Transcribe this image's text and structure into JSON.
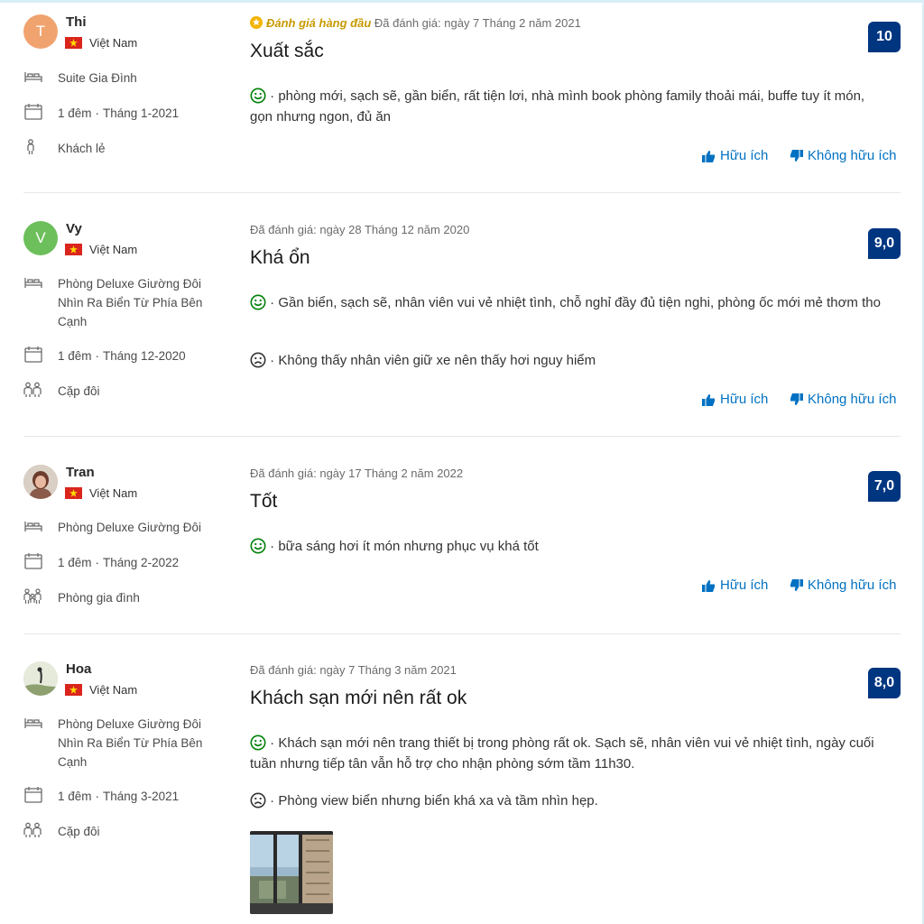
{
  "labels": {
    "helpful": "Hữu ích",
    "not_helpful": "Không hữu ích",
    "top_review": "Đánh giá hàng đầu"
  },
  "colors": {
    "score_bg": "#003580",
    "link": "#0071c2",
    "positive": "#008009",
    "top_badge": "#f4b400"
  },
  "reviews": [
    {
      "avatar_letter": "T",
      "avatar_color": "#f0a36f",
      "name": "Thi",
      "country": "Việt Nam",
      "room": "Suite Gia Đình",
      "nights": "1 đêm",
      "stay_month": "Tháng 1-2021",
      "traveler_type": "Khách lẻ",
      "review_date": "Đã đánh giá: ngày 7 Tháng 2 năm 2021",
      "title": "Xuất sắc",
      "score": "10",
      "positive": "phòng mới, sạch sẽ, gần biển, rất tiện lơi, nhà mình book phòng family thoải mái, buffe tuy ít món, gọn nhưng ngon, đủ ăn"
    },
    {
      "avatar_letter": "V",
      "avatar_color": "#6cbf5a",
      "name": "Vy",
      "country": "Việt Nam",
      "room": "Phòng Deluxe Giường Đôi Nhìn Ra Biển Từ Phía Bên Cạnh",
      "nights": "1 đêm",
      "stay_month": "Tháng 12-2020",
      "traveler_type": "Cặp đôi",
      "review_date": "Đã đánh giá: ngày 28 Tháng 12 năm 2020",
      "title": "Khá ổn",
      "score": "9,0",
      "positive": "Gần biển, sạch sẽ, nhân viên vui vẻ nhiệt tình, chỗ nghỉ đầy đủ tiện nghi, phòng ốc mới mẻ thơm tho",
      "negative": "Không thấy nhân viên giữ xe nên thấy hơi nguy hiểm"
    },
    {
      "name": "Tran",
      "country": "Việt Nam",
      "room": "Phòng Deluxe Giường Đôi",
      "nights": "1 đêm",
      "stay_month": "Tháng 2-2022",
      "traveler_type": "Phòng gia đình",
      "review_date": "Đã đánh giá: ngày 17 Tháng 2 năm 2022",
      "title": "Tốt",
      "score": "7,0",
      "positive": "bữa sáng hơi ít món nhưng phục vụ khá tốt"
    },
    {
      "name": "Hoa",
      "country": "Việt Nam",
      "room": "Phòng Deluxe Giường Đôi Nhìn Ra Biển Từ Phía Bên Cạnh",
      "nights": "1 đêm",
      "stay_month": "Tháng 3-2021",
      "traveler_type": "Cặp đôi",
      "review_date": "Đã đánh giá: ngày 7 Tháng 3 năm 2021",
      "title": "Khách sạn mới nên rất ok",
      "score": "8,0",
      "positive": "Khách sạn mới nên trang thiết bị trong phòng rất ok. Sạch sẽ, nhân viên vui vẻ nhiệt tình, ngày cuối tuần nhưng tiếp tân vẫn hỗ trợ cho nhận phòng sớm tầm 11h30.",
      "negative": "Phòng view biển nhưng biển khá xa và tầm nhìn hẹp."
    }
  ]
}
